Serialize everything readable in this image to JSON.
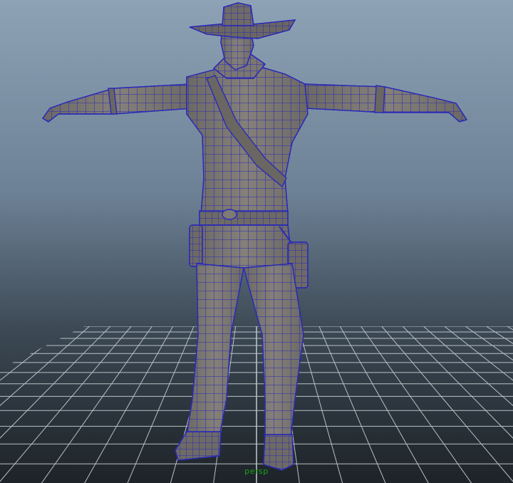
{
  "viewport": {
    "camera_label": "persp",
    "background_top": "#8ea2b6",
    "background_bottom": "#1d2328",
    "grid_color": "#b9c1c8",
    "mesh_fill": "#7e7a76",
    "wireframe_color": "#2a2bb6"
  },
  "model": {
    "name": "cowboy-character",
    "pose": "t-pose",
    "display": "wireframe-on-shaded"
  }
}
